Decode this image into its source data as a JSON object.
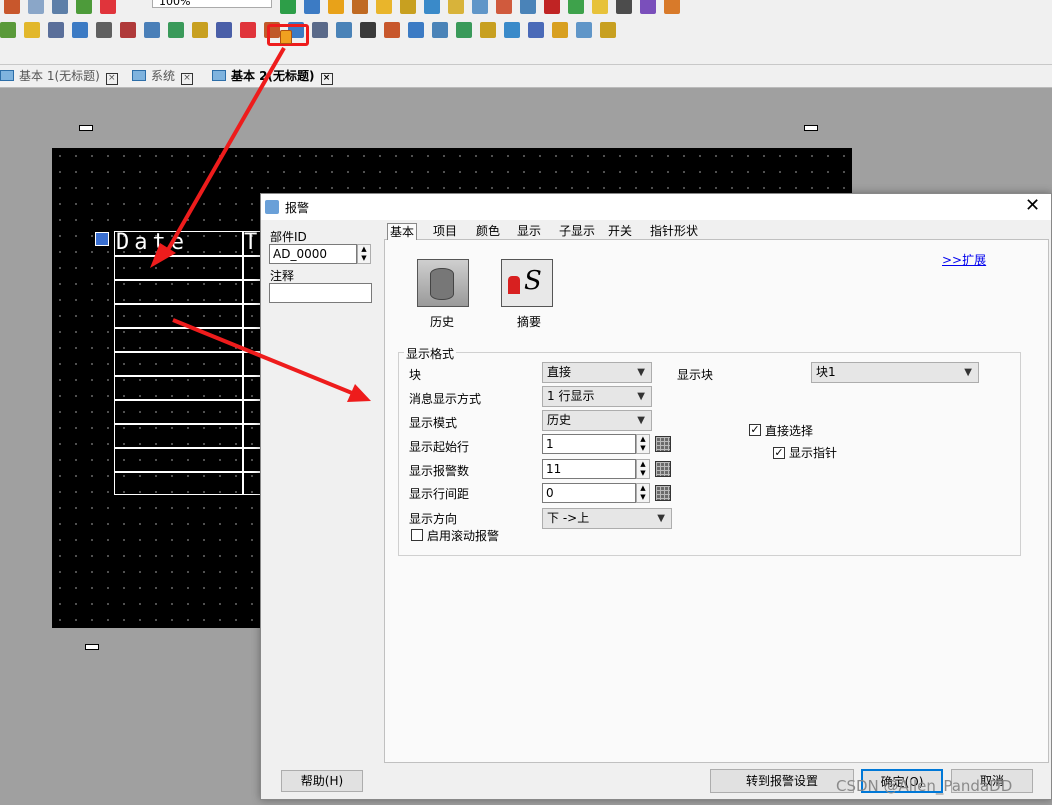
{
  "toolbar": {
    "zoom": "100%",
    "row1_colors": [
      "#c8572c",
      "#8aa6c8",
      "#5d7fa8",
      "#4d9b3a",
      "#e0343b",
      "#2d9e48",
      "#3c7bc4",
      "#e8a219",
      "#c06a23",
      "#e9b52b",
      "#c8a020",
      "#3a8ac9",
      "#d8b33a",
      "#6096c8",
      "#d05a3d",
      "#4a83b8",
      "#c02424",
      "#3ea24b",
      "#e7c23a",
      "#4c4c4c",
      "#7a4fbb",
      "#d87a2a"
    ],
    "row2_colors": [
      "#5a9a3a",
      "#e2b72b",
      "#5a6f9a",
      "#3c7bc4",
      "#606060",
      "#b03a3a",
      "#4a7fb8",
      "#3a9a5a",
      "#c8a020",
      "#4a5fa8",
      "#e0343b",
      "#c05a2a",
      "#3c7bc4",
      "#5a6a8a",
      "#4a83b8",
      "#3a3a3a",
      "#c8572c",
      "#3c7bc4",
      "#4a83b8",
      "#3a9a5a",
      "#c8a020",
      "#3a8ac9",
      "#4a6ab8",
      "#d8a020",
      "#6096c8",
      "#c8a020"
    ]
  },
  "tabs": [
    {
      "label": "基本 1(无标题)"
    },
    {
      "label": "系统"
    },
    {
      "label": "基本 2(无标题)"
    }
  ],
  "canvas": {
    "date_text": "Date",
    "col2_text": "T"
  },
  "dialog": {
    "title": "报警",
    "part_id_label": "部件ID",
    "part_id_value": "AD_0000",
    "note_label": "注释",
    "note_value": "",
    "tabs": [
      "基本",
      "项目",
      "颜色",
      "显示",
      "子显示",
      "开关",
      "指针形状"
    ],
    "expand_link": ">>扩展",
    "type_history": "历史",
    "type_summary": "摘要",
    "group_title": "显示格式",
    "block_label": "块",
    "block_value": "直接",
    "msg_mode_label": "消息显示方式",
    "msg_mode_value": "1 行显示",
    "display_mode_label": "显示模式",
    "display_mode_value": "历史",
    "start_row_label": "显示起始行",
    "start_row_value": "1",
    "alarm_count_label": "显示报警数",
    "alarm_count_value": "11",
    "row_spacing_label": "显示行间距",
    "row_spacing_value": "0",
    "direction_label": "显示方向",
    "direction_value": "下 ->上",
    "scroll_label": "启用滚动报警",
    "scroll_checked": false,
    "display_block_label": "显示块",
    "display_block_value": "块1",
    "direct_select_label": "直接选择",
    "direct_select_checked": true,
    "show_pointer_label": "显示指针",
    "show_pointer_checked": true,
    "help_button": "帮助(H)",
    "goto_alarm_button": "转到报警设置",
    "ok_button": "确定(O)",
    "cancel_button": "取消"
  },
  "watermark": "CSDN @Allen_PandaDD",
  "colors": {
    "highlight": "#ee1c1c",
    "arrow": "#ee1c1c",
    "link": "#0000ee"
  }
}
